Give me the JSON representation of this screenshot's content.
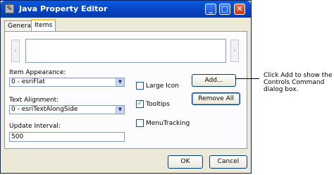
{
  "window": {
    "title": "Java Property Editor",
    "minimize_glyph": "_",
    "maximize_glyph": "□",
    "close_glyph": "✕",
    "app_icon_glyph": "✎"
  },
  "tabs": [
    {
      "label": "General",
      "active": false
    },
    {
      "label": "Items",
      "active": true
    }
  ],
  "preview": {
    "left_arrow": "‹",
    "right_arrow": "›"
  },
  "form": {
    "item_appearance_label": "Item Appearance:",
    "item_appearance_value": "0 - esriFlat",
    "text_alignment_label": "Text Alignment:",
    "text_alignment_value": "0 - esriTextAlongSide",
    "update_interval_label": "Update Interval:",
    "update_interval_value": "500",
    "dropdown_arrow": "▼"
  },
  "options": {
    "large_icon": {
      "label": "Large Icon",
      "checked": false
    },
    "tooltips": {
      "label": "Tooltips",
      "checked": true,
      "check_glyph": "✓"
    },
    "menu_tracking": {
      "label": "MenuTracking",
      "checked": false
    }
  },
  "buttons": {
    "add": "Add...",
    "remove_all": "Remove All",
    "ok": "OK",
    "cancel": "Cancel"
  },
  "callout": {
    "line1": "Click Add to show the",
    "line2": "Controls Command",
    "line3": "dialog box."
  }
}
